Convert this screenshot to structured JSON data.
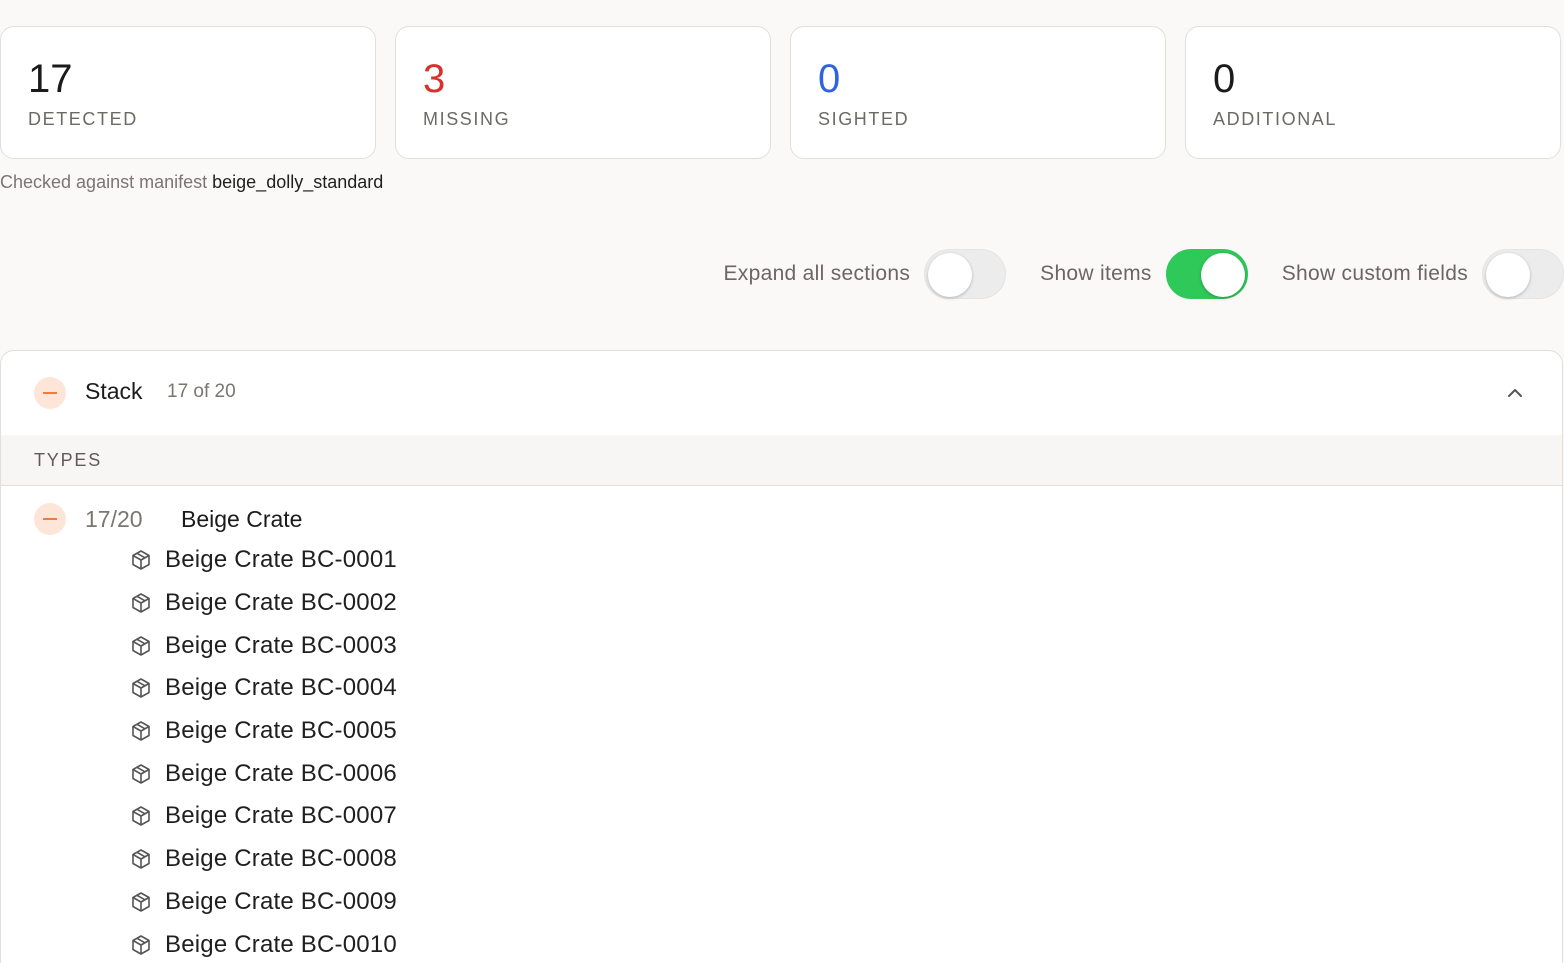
{
  "stats": [
    {
      "value": "17",
      "label": "DETECTED",
      "color": "#1b1b1b"
    },
    {
      "value": "3",
      "label": "MISSING",
      "color": "#d9302c"
    },
    {
      "value": "0",
      "label": "SIGHTED",
      "color": "#2f64e0"
    },
    {
      "value": "0",
      "label": "ADDITIONAL",
      "color": "#1b1b1b"
    }
  ],
  "manifest": {
    "prefix": "Checked against manifest",
    "name": "beige_dolly_standard"
  },
  "toggles": {
    "expand_all": {
      "label": "Expand all sections",
      "on": false
    },
    "show_items": {
      "label": "Show items",
      "on": true
    },
    "show_custom_fields": {
      "label": "Show custom fields",
      "on": false
    }
  },
  "section": {
    "title": "Stack",
    "count": "17 of 20",
    "types_header": "TYPES",
    "type_row": {
      "count": "17/20",
      "name": "Beige Crate"
    },
    "items": [
      "Beige Crate BC-0001",
      "Beige Crate BC-0002",
      "Beige Crate BC-0003",
      "Beige Crate BC-0004",
      "Beige Crate BC-0005",
      "Beige Crate BC-0006",
      "Beige Crate BC-0007",
      "Beige Crate BC-0008",
      "Beige Crate BC-0009",
      "Beige Crate BC-0010"
    ],
    "item_icon": "box-icon"
  },
  "colors": {
    "accent_toggle_on": "#2fc95a",
    "missing_badge_bg": "#fde6d8",
    "missing_badge_fg": "#ee7b3f"
  }
}
